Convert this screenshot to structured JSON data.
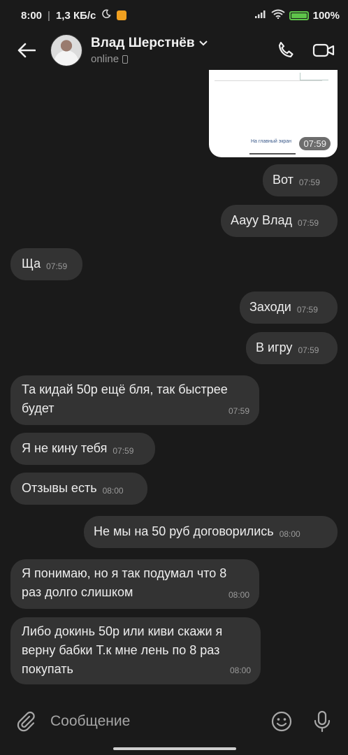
{
  "status_bar": {
    "time": "8:00",
    "speed": "1,3 КБ/с",
    "battery": "100%"
  },
  "header": {
    "contact_name": "Влад Шерстнёв",
    "status": "online",
    "icons": [
      "back-arrow-icon",
      "phone-icon",
      "video-camera-icon",
      "chevron-down-icon"
    ]
  },
  "image_message": {
    "caption": "На главный экран",
    "time": "07:59"
  },
  "messages": [
    {
      "dir": "out",
      "text": "Вот",
      "time": "07:59"
    },
    {
      "dir": "out",
      "text": "Аауу Влад",
      "time": "07:59"
    },
    {
      "dir": "in",
      "text": "Ща",
      "time": "07:59"
    },
    {
      "dir": "out",
      "text": "Заходи",
      "time": "07:59"
    },
    {
      "dir": "out",
      "text": "В игру",
      "time": "07:59"
    },
    {
      "dir": "in",
      "text": "Та кидай 50р ещё бля, так быстрее\nбудет",
      "time": "07:59"
    },
    {
      "dir": "in",
      "text": "Я не кину тебя",
      "time": "07:59"
    },
    {
      "dir": "in",
      "text": "Отзывы есть",
      "time": "08:00"
    },
    {
      "dir": "out",
      "text": "Не мы на 50 руб договорились",
      "time": "08:00"
    },
    {
      "dir": "in",
      "text": "Я понимаю, но я так подумал что 8\nраз долго слишком",
      "time": "08:00"
    },
    {
      "dir": "in",
      "text": "Либо докинь 50р или киви скажи я\nверну бабки Т.к мне лень по 8 раз\nпокупать",
      "time": "08:00"
    }
  ],
  "input": {
    "placeholder": "Сообщение"
  },
  "colors": {
    "background": "#1a1a1a",
    "bubble": "#333333",
    "timestamp": "#9a9a9a",
    "battery": "#5ec44a"
  }
}
